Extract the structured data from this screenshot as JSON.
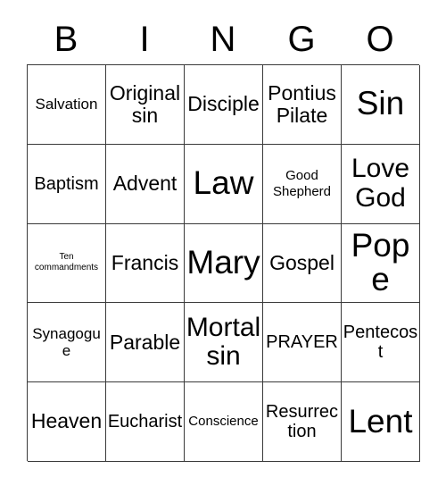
{
  "card": {
    "title": "Bingo Card",
    "header_letters": [
      "B",
      "I",
      "N",
      "G",
      "O"
    ],
    "columns": 5,
    "rows": 5,
    "border_color": "#3a3a3a",
    "background_color": "#ffffff",
    "text_color": "#000000",
    "cells": [
      [
        {
          "label": "Salvation",
          "size": "smd"
        },
        {
          "label": "Original sin",
          "size": "lg"
        },
        {
          "label": "Disciple",
          "size": "lg"
        },
        {
          "label": "Pontius Pilate",
          "size": "lg"
        },
        {
          "label": "Sin",
          "size": "xxl"
        }
      ],
      [
        {
          "label": "Baptism",
          "size": "md"
        },
        {
          "label": "Advent",
          "size": "lg"
        },
        {
          "label": "Law",
          "size": "xxl"
        },
        {
          "label": "Good Shepherd",
          "size": "sm"
        },
        {
          "label": "Love God",
          "size": "xl"
        }
      ],
      [
        {
          "label": "Ten commandments",
          "size": "xs"
        },
        {
          "label": "Francis",
          "size": "lg"
        },
        {
          "label": "Mary",
          "size": "xxl"
        },
        {
          "label": "Gospel",
          "size": "lg"
        },
        {
          "label": "Pope",
          "size": "xxl"
        }
      ],
      [
        {
          "label": "Synagogue",
          "size": "smd"
        },
        {
          "label": "Parable",
          "size": "lg"
        },
        {
          "label": "Mortal sin",
          "size": "xl"
        },
        {
          "label": "PRAYER",
          "size": "md"
        },
        {
          "label": "Pentecost",
          "size": "md"
        }
      ],
      [
        {
          "label": "Heaven",
          "size": "lg"
        },
        {
          "label": "Eucharist",
          "size": "md"
        },
        {
          "label": "Conscience",
          "size": "sm"
        },
        {
          "label": "Resurrection",
          "size": "md"
        },
        {
          "label": "Lent",
          "size": "xxl"
        }
      ]
    ]
  }
}
